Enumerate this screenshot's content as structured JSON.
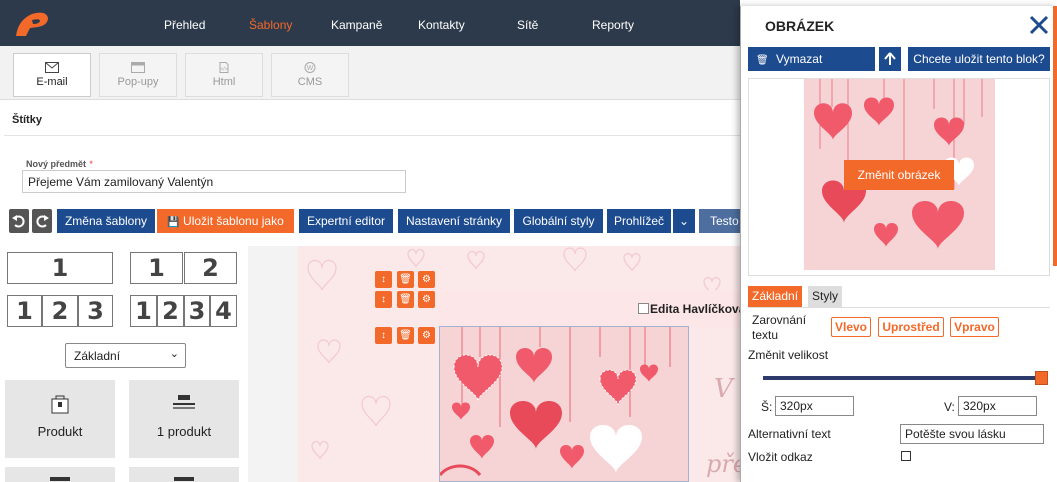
{
  "nav": {
    "items": [
      "Přehled",
      "Šablony",
      "Kampaně",
      "Kontakty",
      "Sítě",
      "Reporty"
    ],
    "active": "Šablony"
  },
  "content_tabs": [
    {
      "label": "E-mail",
      "icon": "envelope-icon"
    },
    {
      "label": "Pop-upy",
      "icon": "popup-window-icon"
    },
    {
      "label": "Html",
      "icon": "html-file-icon"
    },
    {
      "label": "CMS",
      "icon": "wordpress-icon"
    }
  ],
  "tags": {
    "label": "Štítky"
  },
  "subject": {
    "label": "Nový předmět",
    "required_mark": "*",
    "value": "Přejeme Vám zamilovaný Valentýn"
  },
  "toolbar": {
    "change_template": "Změna šablony",
    "save_template_as": "Uložit šablonu jako",
    "expert_editor": "Expertní editor",
    "page_settings": "Nastavení stránky",
    "global_styles": "Globální styly",
    "browser": "Prohlížeč",
    "test": "Testo"
  },
  "layouts": {
    "row1": [
      "1"
    ],
    "row2": [
      "1",
      "2"
    ],
    "row3": [
      "1",
      "2",
      "3"
    ],
    "row4": [
      "1",
      "2",
      "3",
      "4"
    ]
  },
  "block_select": {
    "value": "Základní"
  },
  "blocks": [
    {
      "label": "Produkt",
      "icon": "shopping-bag-icon"
    },
    {
      "label": "1 produkt",
      "icon": "product-row-icon"
    }
  ],
  "canvas": {
    "sender_name": "Edita Havlíčková",
    "overlay_text_1": "V",
    "overlay_text_2": "přejeme"
  },
  "panel": {
    "title": "OBRÁZEK",
    "delete_label": "Vymazat",
    "save_block_label": "Chcete uložit tento blok?",
    "change_image_label": "Změnit obrázek",
    "tabs": [
      "Základní",
      "Styly"
    ],
    "align_label_1": "Zarovnání",
    "align_label_2": "textu",
    "align_left": "Vlevo",
    "align_center": "Uprostřed",
    "align_right": "Vpravo",
    "resize_label": "Změnit velikost",
    "resize_level": 1.0,
    "width_label": "Š:",
    "width_value": "320px",
    "height_label": "V:",
    "height_value": "320px",
    "alt_label": "Alternativní text",
    "alt_value": "Potěšte svou lásku",
    "link_label": "Vložit odkaz"
  },
  "colors": {
    "accent": "#f2692a",
    "primary": "#1d4b8f",
    "nav_bg": "#2d3a4b",
    "heart_red": "#f05a6a",
    "heart_pink": "#f8c8cc"
  }
}
